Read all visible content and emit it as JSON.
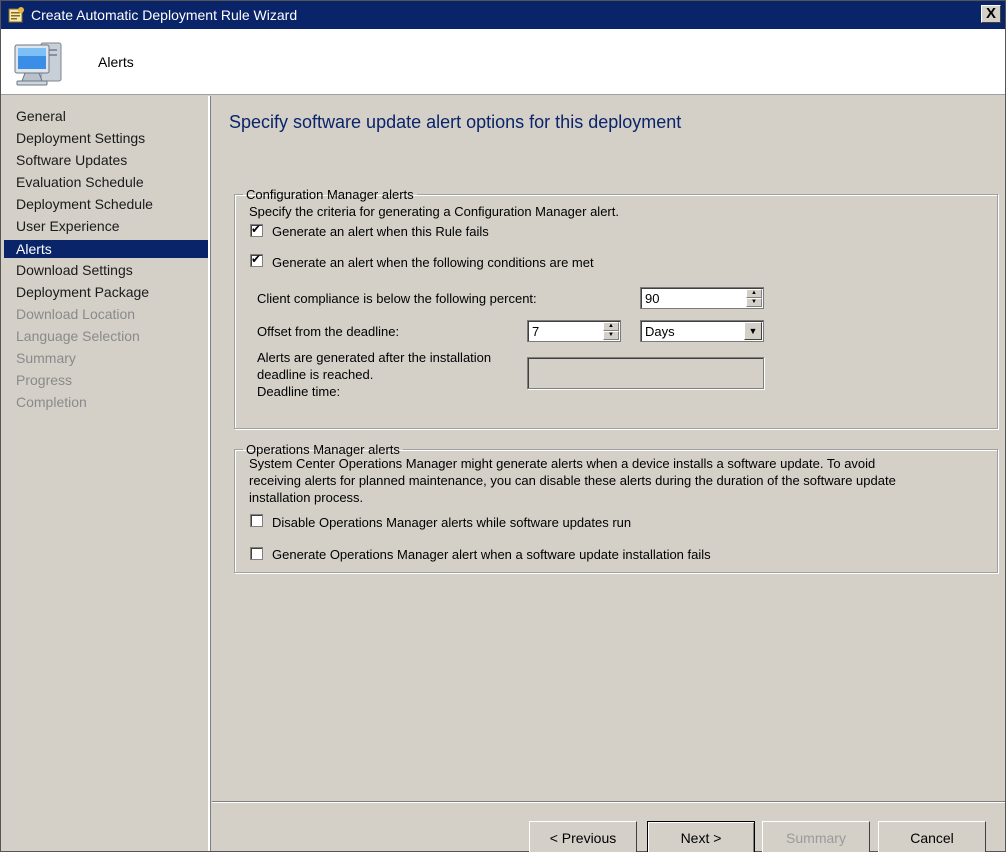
{
  "window": {
    "title": "Create Automatic Deployment Rule Wizard",
    "close_label": "X"
  },
  "header": {
    "page_name": "Alerts",
    "icon": "computer-icon"
  },
  "sidebar": {
    "items": [
      {
        "label": "General",
        "state": "normal"
      },
      {
        "label": "Deployment Settings",
        "state": "normal"
      },
      {
        "label": "Software Updates",
        "state": "normal"
      },
      {
        "label": "Evaluation Schedule",
        "state": "normal"
      },
      {
        "label": "Deployment Schedule",
        "state": "normal"
      },
      {
        "label": "User Experience",
        "state": "normal"
      },
      {
        "label": "Alerts",
        "state": "selected"
      },
      {
        "label": "Download Settings",
        "state": "normal"
      },
      {
        "label": "Deployment Package",
        "state": "normal"
      },
      {
        "label": "Download Location",
        "state": "disabled"
      },
      {
        "label": "Language Selection",
        "state": "disabled"
      },
      {
        "label": "Summary",
        "state": "disabled"
      },
      {
        "label": "Progress",
        "state": "disabled"
      },
      {
        "label": "Completion",
        "state": "disabled"
      }
    ]
  },
  "main": {
    "heading": "Specify software update alert options for this deployment",
    "cm_group": {
      "legend": "Configuration Manager alerts",
      "description": "Specify the criteria for generating a Configuration Manager alert.",
      "rule_fails_label": "Generate an alert when this Rule fails",
      "rule_fails_checked": true,
      "conditions_label": "Generate an alert when the following conditions are met",
      "conditions_checked": true,
      "compliance_label": "Client compliance is below the  following percent:",
      "compliance_value": "90",
      "offset_label": "Offset from the deadline:",
      "offset_value": "7",
      "offset_unit": "Days",
      "deadline_note_line1": "Alerts are generated after the installation",
      "deadline_note_line2": "deadline is reached.",
      "deadline_time_label": "Deadline time:",
      "deadline_time_value": ""
    },
    "om_group": {
      "legend": "Operations Manager alerts",
      "description_line1": "System Center Operations Manager might generate alerts when a device installs a software update. To avoid",
      "description_line2": "receiving alerts for planned maintenance, you can disable these alerts during the duration of the software update",
      "description_line3": "installation process.",
      "disable_label": "Disable Operations Manager alerts while software updates run",
      "disable_checked": false,
      "generate_fail_label": "Generate Operations Manager alert when a software update installation fails",
      "generate_fail_checked": false
    }
  },
  "footer": {
    "previous_label": "< Previous",
    "next_label": "Next >",
    "summary_label": "Summary",
    "cancel_label": "Cancel"
  },
  "colors": {
    "selection": "#0a246a",
    "heading": "#0a246a",
    "face": "#d4d0c8"
  }
}
